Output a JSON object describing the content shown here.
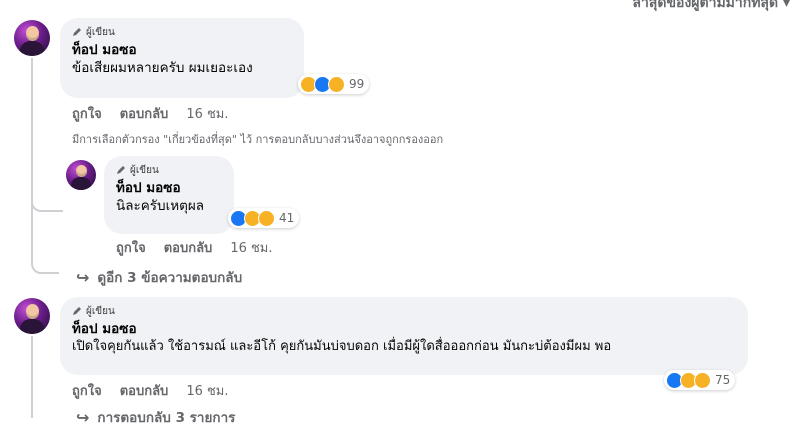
{
  "sort": {
    "label": "ล่าสุดของผู้ตามมากที่สุด ▾"
  },
  "author_badge": "ผู้เขียน",
  "comments": [
    {
      "name": "ท็อป มอซอ",
      "text": "ข้อเสียผมหลายครับ ผมเยอะเอง",
      "reactions_count": "99",
      "like": "ถูกใจ",
      "reply": "ตอบกลับ",
      "time": "16 ชม."
    },
    {
      "name": "ท็อป มอซอ",
      "text": "นิละครับเหตุผล",
      "reactions_count": "41",
      "like": "ถูกใจ",
      "reply": "ตอบกลับ",
      "time": "16 ชม."
    },
    {
      "name": "ท็อป มอซอ",
      "text": "เปิดใจคุยกันแล้ว ใช้อารมณ์ และอีโก้ คุยกันมันบ่จบดอก เมื่อมีผู้ใดสื่อออกก่อน มันกะบ่ต้องมีผม พอ",
      "reactions_count": "75",
      "like": "ถูกใจ",
      "reply": "ตอบกลับ",
      "time": "16 ชม."
    }
  ],
  "filter_note": "มีการเลือกตัวกรอง \"เกี่ยวข้องที่สุด\" ไว้ การตอบกลับบางส่วนจึงอาจถูกกรองออก",
  "view_more": "ดูอีก 3 ข้อความตอบกลับ",
  "view_replies": "การตอบกลับ 3 รายการ"
}
